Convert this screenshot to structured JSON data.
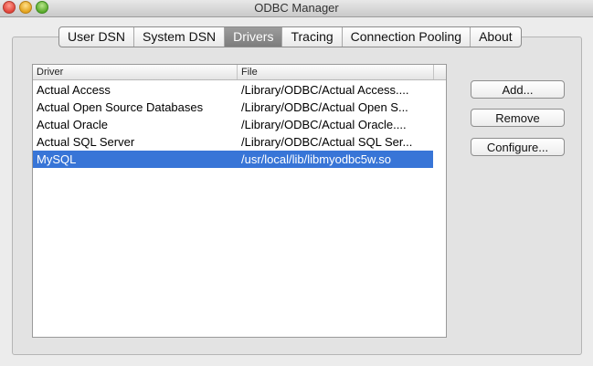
{
  "window": {
    "title": "ODBC Manager"
  },
  "tabs": [
    {
      "label": "User DSN",
      "active": false
    },
    {
      "label": "System DSN",
      "active": false
    },
    {
      "label": "Drivers",
      "active": true
    },
    {
      "label": "Tracing",
      "active": false
    },
    {
      "label": "Connection Pooling",
      "active": false
    },
    {
      "label": "About",
      "active": false
    }
  ],
  "table": {
    "columns": [
      "Driver",
      "File"
    ],
    "rows": [
      {
        "driver": "Actual Access",
        "file": "/Library/ODBC/Actual Access....",
        "selected": false
      },
      {
        "driver": "Actual Open Source Databases",
        "file": "/Library/ODBC/Actual Open S...",
        "selected": false
      },
      {
        "driver": "Actual Oracle",
        "file": "/Library/ODBC/Actual Oracle....",
        "selected": false
      },
      {
        "driver": "Actual SQL Server",
        "file": "/Library/ODBC/Actual SQL Ser...",
        "selected": false
      },
      {
        "driver": "MySQL",
        "file": "/usr/local/lib/libmyodbc5w.so",
        "selected": true
      }
    ]
  },
  "buttons": {
    "add": "Add...",
    "remove": "Remove",
    "configure": "Configure..."
  },
  "colors": {
    "selection": "#3875d7",
    "active_tab": "#8a8a8a"
  }
}
